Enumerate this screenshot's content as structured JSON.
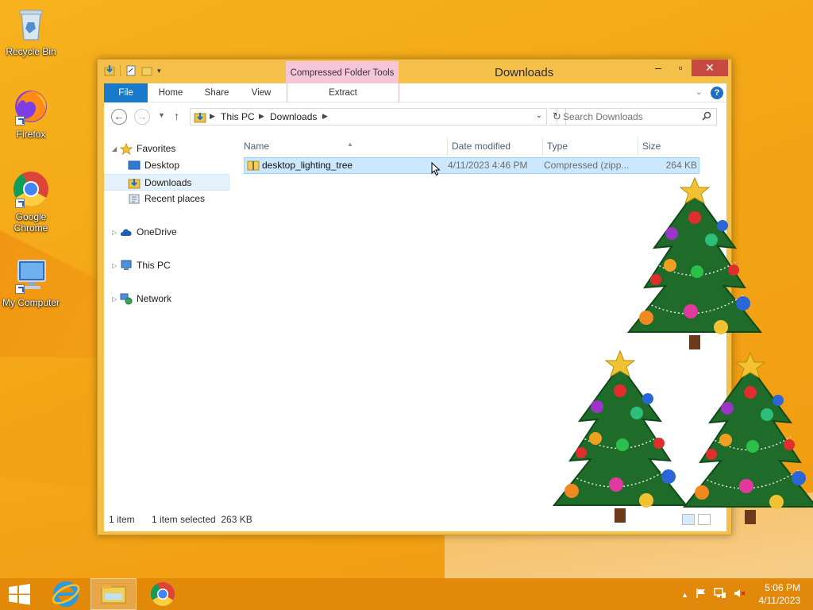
{
  "desktop": {
    "icons": [
      {
        "label": "Recycle Bin"
      },
      {
        "label": "Firefox"
      },
      {
        "label": "Google Chrome"
      },
      {
        "label": "My Computer"
      }
    ]
  },
  "window": {
    "title": "Downloads",
    "contextual_tab_group": "Compressed Folder Tools",
    "ribbon_tabs": {
      "file": "File",
      "home": "Home",
      "share": "Share",
      "view": "View",
      "extract": "Extract"
    },
    "address": {
      "crumbs": [
        "This PC",
        "Downloads"
      ]
    },
    "search": {
      "placeholder": "Search Downloads"
    },
    "nav_pane": {
      "favorites": "Favorites",
      "desktop": "Desktop",
      "downloads": "Downloads",
      "recent_places": "Recent places",
      "onedrive": "OneDrive",
      "this_pc": "This PC",
      "network": "Network"
    },
    "columns": {
      "name": "Name",
      "date_modified": "Date modified",
      "type": "Type",
      "size": "Size"
    },
    "files": [
      {
        "name": "desktop_lighting_tree",
        "date_modified": "4/11/2023 4:46 PM",
        "type": "Compressed (zipp...",
        "size": "264 KB"
      }
    ],
    "status": {
      "item_count": "1 item",
      "selection": "1 item selected  263 KB"
    }
  },
  "taskbar": {
    "clock_time": "5:06 PM",
    "clock_date": "4/11/2023"
  },
  "colors": {
    "accent": "#1979ca",
    "selection_bg": "#cce8ff",
    "desktop_bg": "#f3a516",
    "close_button": "#c74a42"
  }
}
